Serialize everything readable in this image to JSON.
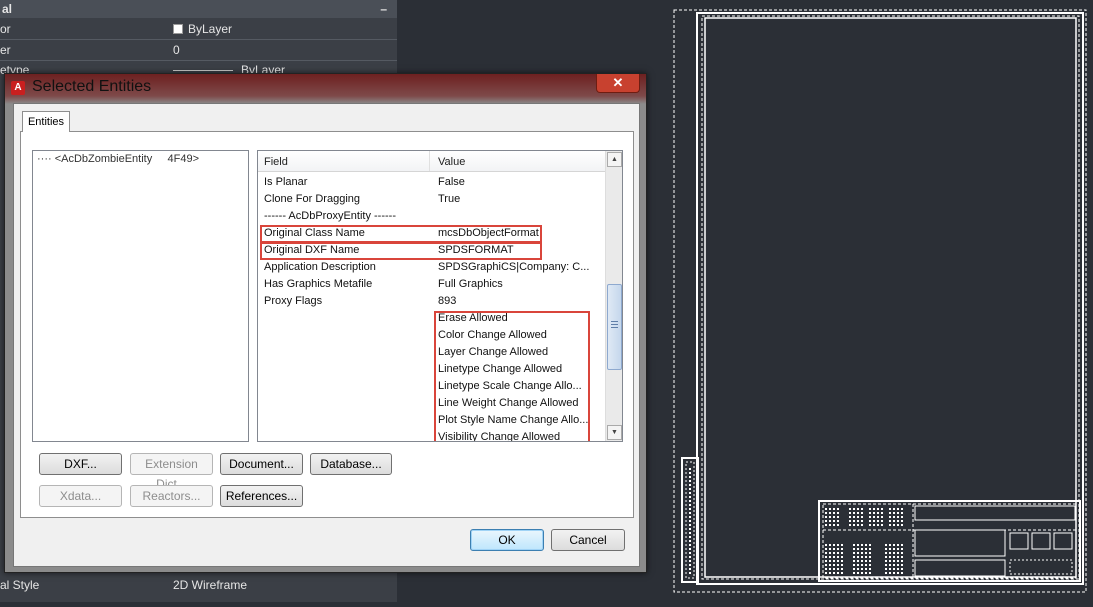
{
  "properties_palette": {
    "header": "al",
    "header_button": "–",
    "rows": [
      {
        "key": "or",
        "value": "ByLayer",
        "swatch_color": "#ffffff"
      },
      {
        "key": "er",
        "value": "0"
      },
      {
        "key": "etype",
        "value": "ByLayer"
      }
    ],
    "bottom_row": {
      "key": "al Style",
      "value": "2D Wireframe"
    }
  },
  "dialog": {
    "title": "Selected Entities",
    "close_label": "✕",
    "tab_label": "Entities",
    "tree_item": "···· <AcDbZombieEntity     4F49>",
    "grid": {
      "columns": [
        "Field",
        "Value"
      ],
      "rows": [
        {
          "field": "Is Planar",
          "value": "False"
        },
        {
          "field": "Clone For Dragging",
          "value": "True"
        },
        {
          "field": "------ AcDbProxyEntity ------",
          "value": ""
        },
        {
          "field": "Original Class Name",
          "value": "mcsDbObjectFormat"
        },
        {
          "field": "Original DXF Name",
          "value": "SPDSFORMAT"
        },
        {
          "field": "Application Description",
          "value": "SPDSGraphiCS|Company: C..."
        },
        {
          "field": "Has Graphics Metafile",
          "value": "Full Graphics"
        },
        {
          "field": "Proxy Flags",
          "value": "893"
        },
        {
          "field": "",
          "value": "Erase Allowed"
        },
        {
          "field": "",
          "value": "Color Change Allowed"
        },
        {
          "field": "",
          "value": "Layer Change Allowed"
        },
        {
          "field": "",
          "value": "Linetype Change Allowed"
        },
        {
          "field": "",
          "value": "Linetype Scale Change Allo..."
        },
        {
          "field": "",
          "value": "Line Weight Change Allowed"
        },
        {
          "field": "",
          "value": "Plot Style Name Change Allo..."
        },
        {
          "field": "",
          "value": "Visibility Change Allowed"
        }
      ]
    },
    "buttons": {
      "dxf": "DXF...",
      "extension_dict": "Extension Dict...",
      "document": "Document...",
      "database": "Database...",
      "xdata": "Xdata...",
      "reactors": "Reactors...",
      "references": "References...",
      "ok": "OK",
      "cancel": "Cancel"
    },
    "highlight_color": "#d9453b"
  },
  "colors": {
    "palette_bg": "#3b3f46",
    "drawing_bg": "#2b2f36",
    "title_bar": "#6d2020"
  }
}
